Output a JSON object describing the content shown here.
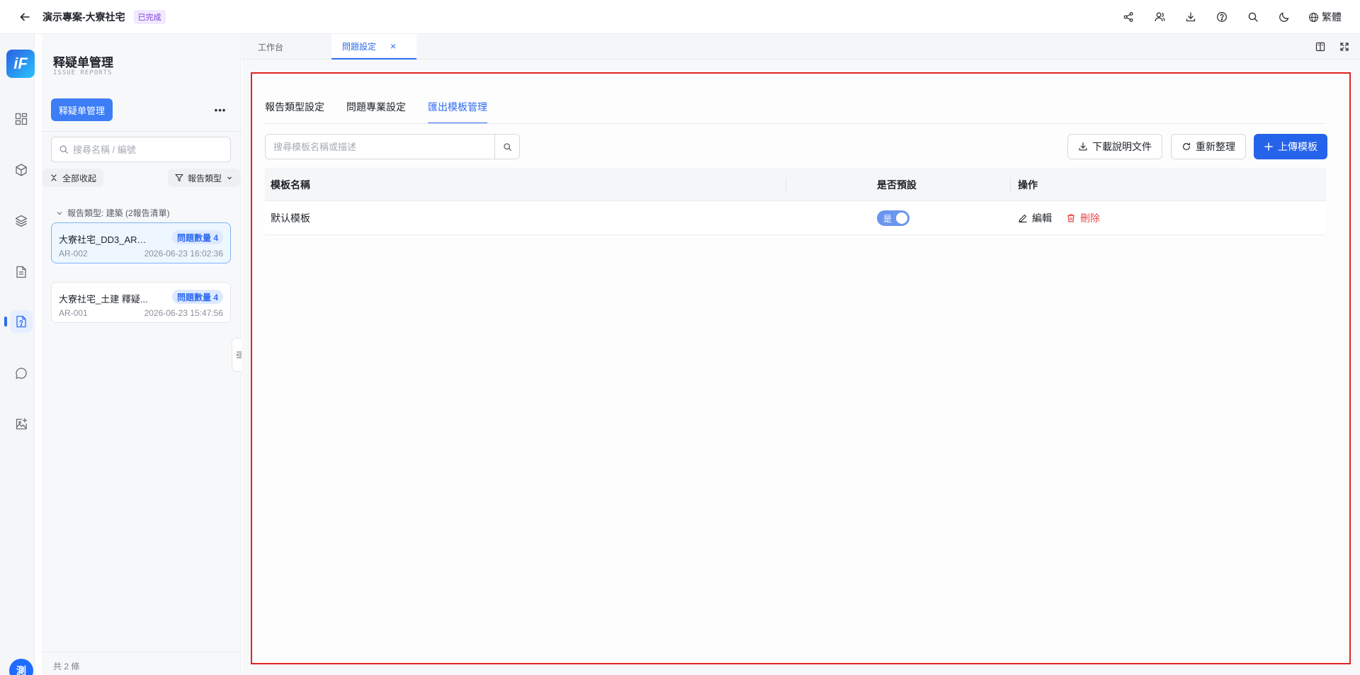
{
  "header": {
    "project_title": "演示專案-大寮社宅",
    "status": "已完成",
    "language": "繁體",
    "icons": [
      "share-icon",
      "members-icon",
      "download-icon",
      "help-icon",
      "search-icon",
      "dark-mode-icon",
      "globe-icon"
    ]
  },
  "rail": {
    "logo": "iF",
    "avatar": "測",
    "items": [
      "dashboard-icon",
      "cube-icon",
      "layers-icon",
      "document-icon",
      "issue-report-icon",
      "chat-icon",
      "image-edit-icon"
    ],
    "active": "issue-report-icon"
  },
  "sidebar": {
    "title": "释疑单管理",
    "subtitle": "ISSUE REPORTS",
    "primary_button": "释疑单管理",
    "search_placeholder": "搜尋名稱 / 編號",
    "collapse_all": "全部收起",
    "filter_label": "報告類型",
    "group_label": "報告類型: 建築 (2報告清單)",
    "items": [
      {
        "name": "大寮社宅_DD3_AR_E...",
        "badge": "問題數量 4",
        "code": "AR-002",
        "time": "2026-06-23 16:02:36"
      },
      {
        "name": "大寮社宅_土建 釋疑...",
        "badge": "問題數量 4",
        "code": "AR-001",
        "time": "2026-06-23 15:47:56"
      }
    ],
    "footer": "共 2 條"
  },
  "tabs": [
    {
      "label": "工作台"
    },
    {
      "label": "問題設定"
    }
  ],
  "settings": {
    "subtabs": [
      "報告類型設定",
      "問題專業設定",
      "匯出模板管理"
    ],
    "active_subtab": "匯出模板管理",
    "search_placeholder": "搜尋模板名稱或描述",
    "buttons": {
      "download_doc": "下載說明文件",
      "refresh": "重新整理",
      "upload": "上傳模板"
    },
    "table": {
      "columns": [
        "模板名稱",
        "是否預設",
        "操作"
      ],
      "rows": [
        {
          "name": "默认模板",
          "default_label": "是",
          "edit": "編輯",
          "delete": "刪除"
        }
      ]
    }
  },
  "colors": {
    "primary": "#2563eb",
    "highlight_border": "#e02424",
    "danger": "#e5484d"
  }
}
